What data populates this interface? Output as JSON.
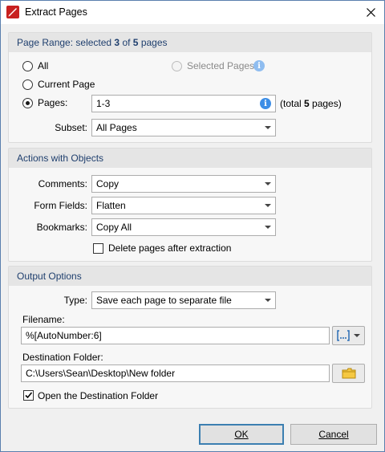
{
  "window": {
    "title": "Extract Pages"
  },
  "page_range": {
    "header_prefix": "Page Range: selected ",
    "selected_count": "3",
    "header_middle": " of ",
    "total_count": "5",
    "header_suffix": " pages",
    "all_label": "All",
    "selected_pages_label": "Selected Pages",
    "current_page_label": "Current Page",
    "pages_label": "Pages:",
    "pages_value": "1-3",
    "total_prefix": "(total ",
    "total_pages": "5",
    "total_suffix": " pages)",
    "subset_label": "Subset:",
    "subset_value": "All Pages",
    "selected_option": "pages"
  },
  "actions": {
    "header": "Actions with Objects",
    "comments_label": "Comments:",
    "comments_value": "Copy",
    "form_fields_label": "Form Fields:",
    "form_fields_value": "Flatten",
    "bookmarks_label": "Bookmarks:",
    "bookmarks_value": "Copy All",
    "delete_label": "Delete pages after extraction",
    "delete_checked": false
  },
  "output": {
    "header": "Output Options",
    "type_label": "Type:",
    "type_value": "Save each page to separate file",
    "filename_label": "Filename:",
    "filename_value": "%[AutoNumber:6]",
    "folder_label": "Destination Folder:",
    "folder_value": "C:\\Users\\Sean\\Desktop\\New folder",
    "open_folder_label": "Open the Destination Folder",
    "open_folder_checked": true
  },
  "buttons": {
    "ok": "OK",
    "cancel": "Cancel"
  },
  "icons": {
    "app": "foxit-pdf-icon",
    "close": "close-icon",
    "info": "info-icon",
    "macro": "macro-icon",
    "folder": "folder-browse-icon"
  },
  "colors": {
    "accent": "#3d8ee6",
    "header_text": "#1f3f6e"
  }
}
